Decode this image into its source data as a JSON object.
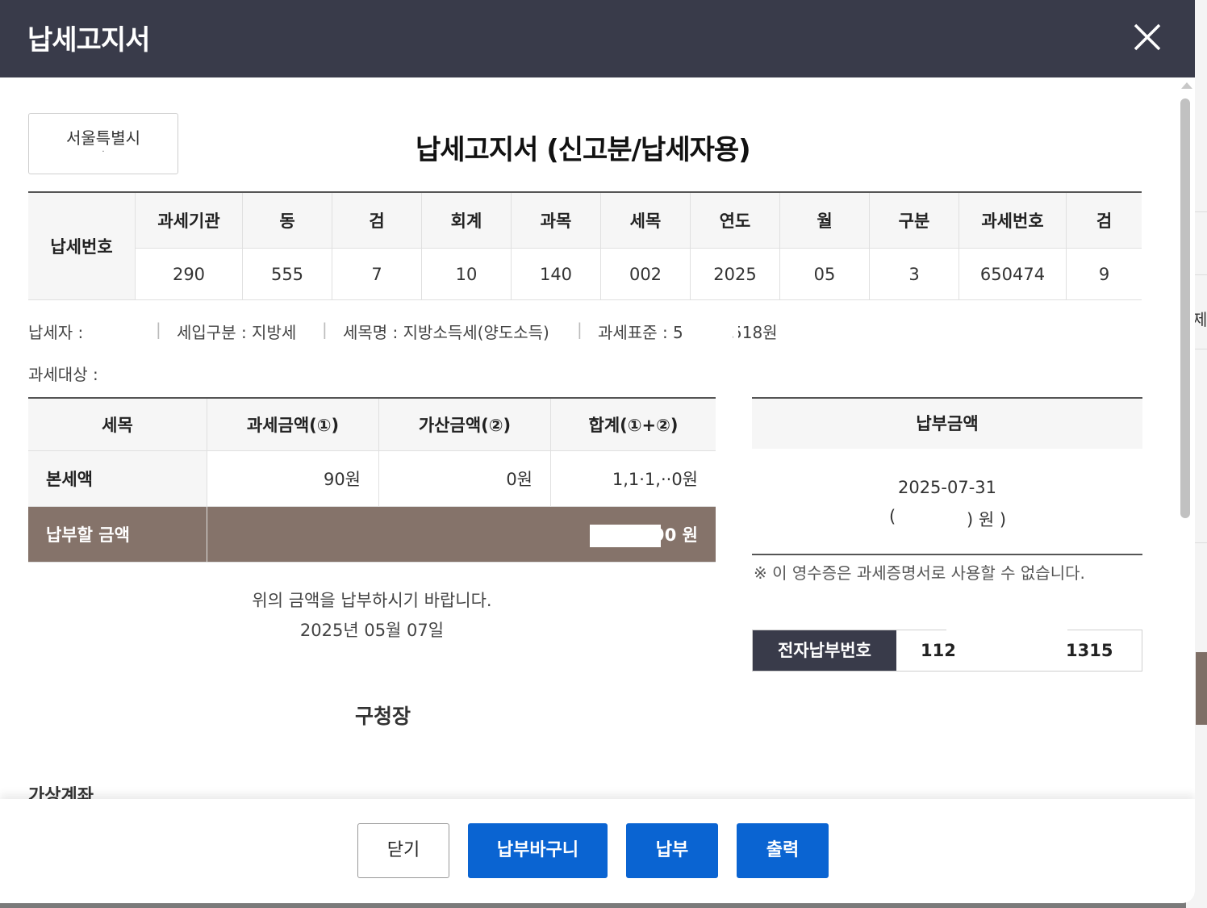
{
  "modal": {
    "title": "납세고지서"
  },
  "doc": {
    "city": "서울특별시",
    "city_sub": "·",
    "title": "납세고지서 (신고분/납세자용)"
  },
  "tax_number": {
    "row_label": "납세번호",
    "headers": [
      "과세기관",
      "동",
      "검",
      "회계",
      "과목",
      "세목",
      "연도",
      "월",
      "구분",
      "과세번호",
      "검"
    ],
    "values": [
      "290",
      "555",
      "7",
      "10",
      "140",
      "002",
      "2025",
      "05",
      "3",
      "650474",
      "9"
    ]
  },
  "info": {
    "taxpayer": "납세자 :",
    "income_type": "세입구분 : 지방세",
    "tax_name": "세목명 : 지방소득세(양도소득)",
    "tax_base_prefix": "과세표준 : 5",
    "tax_base_suffix": "518원",
    "target": "과세대상 :"
  },
  "amounts": {
    "headers": [
      "세목",
      "과세금액(①)",
      "가산금액(②)",
      "합계(①+②)"
    ],
    "main_row": {
      "label": "본세액",
      "tax": "90원",
      "additional": "0원",
      "sum": "1,1·1,··0원"
    },
    "total_row": {
      "label": "납부할 금액",
      "value": "90 원"
    }
  },
  "payment": {
    "header": "납부금액",
    "due_date": "2025-07-31",
    "open_paren": "(",
    "won_label": ") 원 )"
  },
  "notice": "※ 이 영수증은 과세증명서로 사용할 수 없습니다.",
  "epay": {
    "label": "전자납부번호",
    "num_start": "112",
    "num_end": "1315"
  },
  "message": {
    "line1": "위의 금액을 납부하시기 바랍니다.",
    "line2": "2025년 05월 07일"
  },
  "issuer": "구청장",
  "cutoff_section": "가상계좌",
  "buttons": {
    "close": "닫기",
    "basket": "납부바구니",
    "pay": "납부",
    "print": "출력"
  },
  "colors": {
    "header_bg": "#393b4a",
    "primary": "#0a64d2",
    "total_row_bg": "#85736a"
  }
}
